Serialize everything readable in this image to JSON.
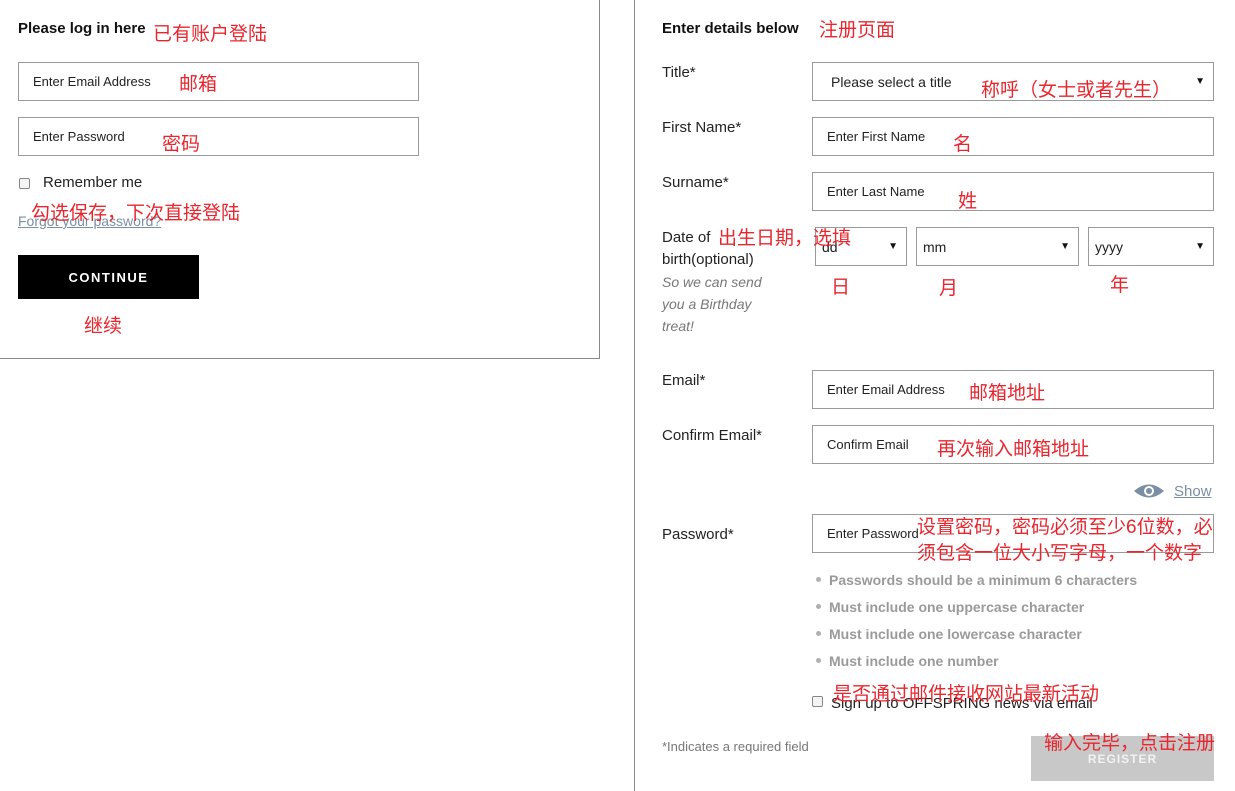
{
  "login": {
    "heading": "Please log in here",
    "email_placeholder": "Enter Email Address",
    "password_placeholder": "Enter Password",
    "remember_label": "Remember me",
    "forgot_link": "Forgot your password?",
    "continue_label": "CONTINUE"
  },
  "register": {
    "heading": "Enter details below",
    "title_label": "Title*",
    "title_select": "Please select a title",
    "first_name_label": "First Name*",
    "first_name_placeholder": "Enter First Name",
    "surname_label": "Surname*",
    "surname_placeholder": "Enter Last Name",
    "dob_label_line1": "Date of",
    "dob_label_line2": "birth(optional)",
    "dob_note": [
      "So we can send",
      "you a Birthday",
      "treat!"
    ],
    "dob_day": "dd",
    "dob_month": "mm",
    "dob_year": "yyyy",
    "email_label": "Email*",
    "email_placeholder": "Enter Email Address",
    "confirm_email_label": "Confirm Email*",
    "confirm_email_placeholder": "Confirm Email",
    "show_label": "Show",
    "password_label": "Password*",
    "password_placeholder": "Enter Password",
    "password_rules": [
      "Passwords should be a minimum 6 characters",
      "Must include one uppercase character",
      "Must include one lowercase character",
      "Must include one number"
    ],
    "newsletter_label": "Sign up to OFFSPRING news via email",
    "required_note": "*Indicates a required field",
    "register_label": "REGISTER"
  },
  "annotations": {
    "login_heading": "已有账户登陆",
    "login_email": "邮箱",
    "login_password": "密码",
    "remember": "勾选保存，下次直接登陆",
    "continue": "继续",
    "reg_heading": "注册页面",
    "title": "称呼（女士或者先生）",
    "first_name": "名",
    "surname": "姓",
    "dob": "出生日期，选填",
    "day": "日",
    "month": "月",
    "year": "年",
    "email": "邮箱地址",
    "confirm_email": "再次输入邮箱地址",
    "password_line1": "设置密码，密码必须至少6位数，必",
    "password_line2": "须包含一位大小写字母，一个数字",
    "newsletter": "是否通过邮件接收网站最新活动",
    "register": "输入完毕，点击注册"
  },
  "colors": {
    "annotation": "#e8262e",
    "continue_bg": "#000000",
    "register_bg": "#c8c8c8",
    "show_link": "#7a8fa3"
  }
}
